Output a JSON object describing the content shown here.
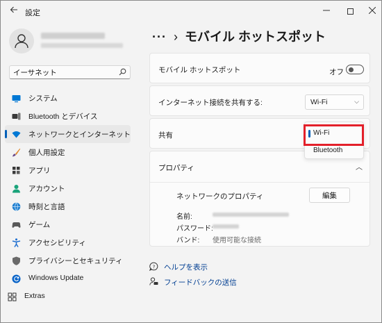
{
  "window": {
    "title": "設定"
  },
  "profile": {
    "name_redacted": true
  },
  "search": {
    "value": "イーサネット"
  },
  "sidebar": {
    "items": [
      {
        "label": "システム",
        "icon": "monitor-icon",
        "color": "#0078d4"
      },
      {
        "label": "Bluetooth とデバイス",
        "icon": "devices-icon",
        "color": "#3a3a3a"
      },
      {
        "label": "ネットワークとインターネット",
        "icon": "wifi-icon",
        "color": "#0078d4",
        "selected": true
      },
      {
        "label": "個人用設定",
        "icon": "brush-icon",
        "color": "#e08a2e"
      },
      {
        "label": "アプリ",
        "icon": "apps-icon",
        "color": "#3a3a3a"
      },
      {
        "label": "アカウント",
        "icon": "person-icon",
        "color": "#1aa37a"
      },
      {
        "label": "時刻と言語",
        "icon": "globe-icon",
        "color": "#1f7fd0"
      },
      {
        "label": "ゲーム",
        "icon": "gamepad-icon",
        "color": "#5a5a5a"
      },
      {
        "label": "アクセシビリティ",
        "icon": "accessibility-icon",
        "color": "#1f6fd0"
      },
      {
        "label": "プライバシーとセキュリティ",
        "icon": "shield-icon",
        "color": "#6a6a6a"
      },
      {
        "label": "Windows Update",
        "icon": "update-icon",
        "color": "#0a64c8"
      },
      {
        "label": "Extras",
        "icon": "grid-icon",
        "color": "#333333"
      }
    ]
  },
  "header": {
    "dots": "···",
    "chevron": "›",
    "title": "モバイル ホットスポット"
  },
  "hotspot": {
    "label": "モバイル ホットスポット",
    "state_label": "オフ",
    "on": false
  },
  "share_connection": {
    "label": "インターネット接続を共有する:",
    "value": "Wi-Fi",
    "chevron": "⌵"
  },
  "share_over": {
    "label": "共有",
    "options": [
      "Wi-Fi",
      "Bluetooth"
    ],
    "selected": "Wi-Fi"
  },
  "properties": {
    "title": "プロパティ",
    "chevron": "︿",
    "network_props_label": "ネットワークのプロパティ",
    "edit_label": "編集",
    "rows": [
      {
        "key": "名前:",
        "redacted": true
      },
      {
        "key": "パスワード:",
        "redacted": true
      },
      {
        "key": "バンド:",
        "value": "使用可能な接続"
      }
    ]
  },
  "links": {
    "help": "ヘルプを表示",
    "feedback": "フィードバックの送信"
  },
  "colors": {
    "accent": "#005fb8",
    "highlight": "#e3202a",
    "link": "#003e92"
  }
}
